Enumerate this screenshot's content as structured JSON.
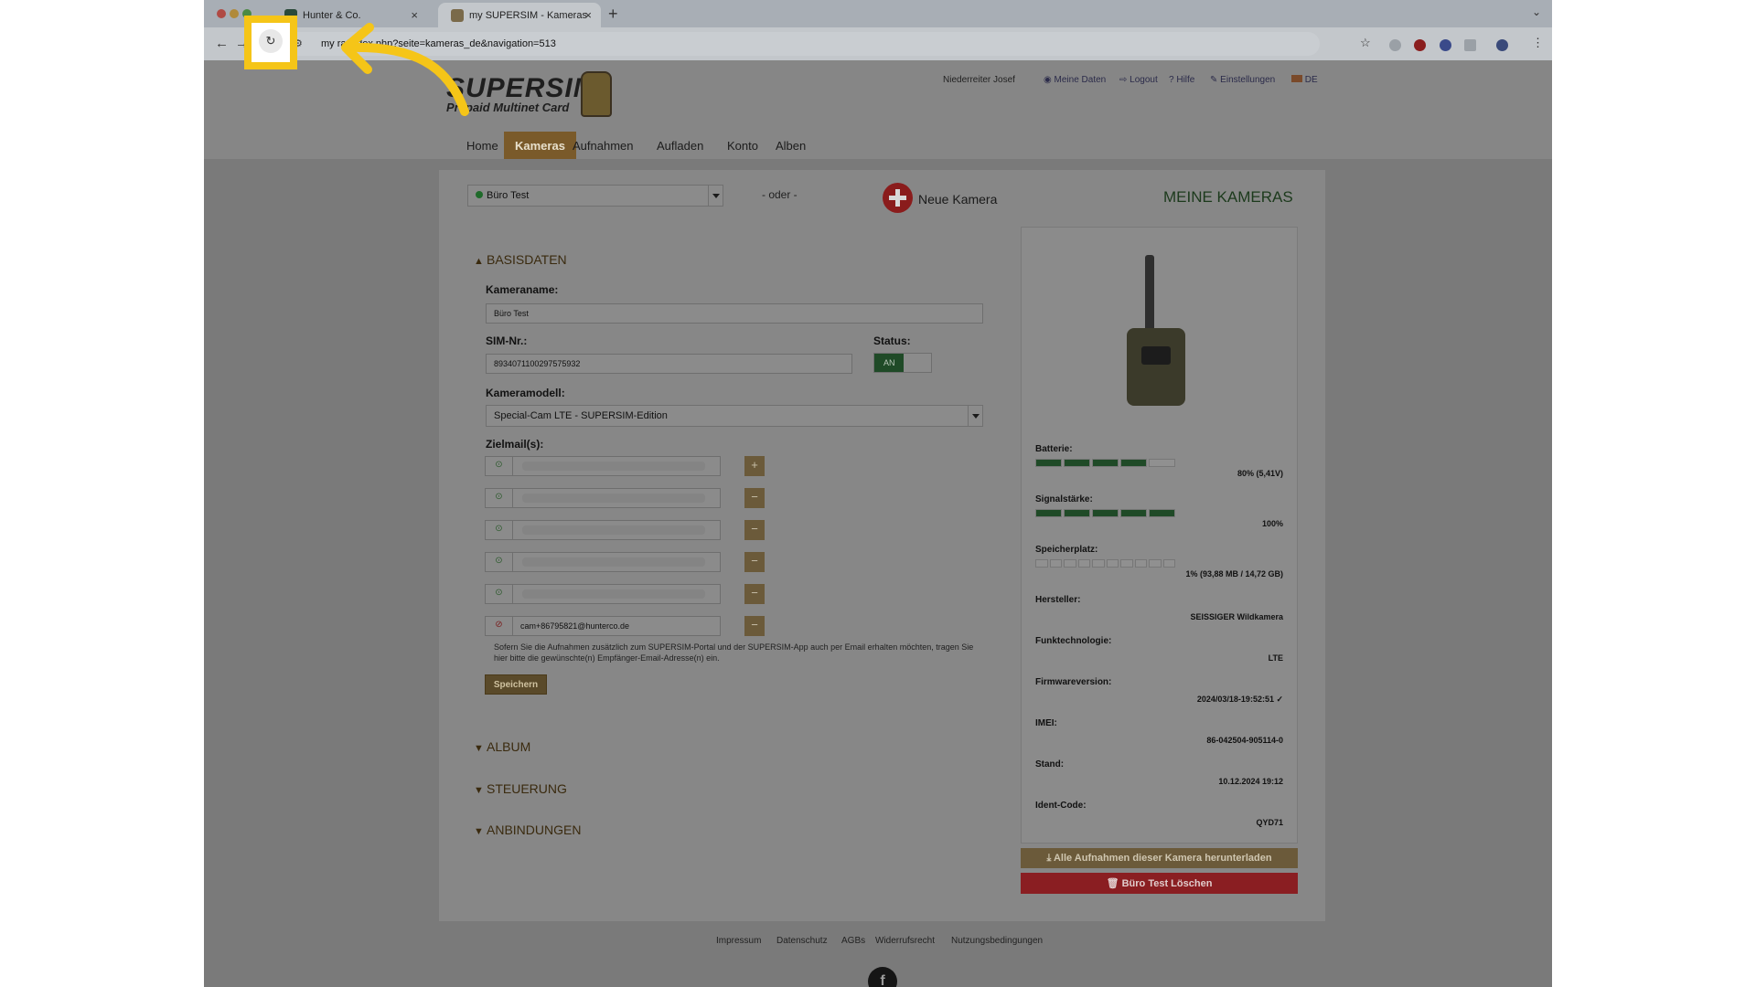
{
  "browser": {
    "tabs": [
      {
        "label": "Hunter & Co."
      },
      {
        "label": "my SUPERSIM - Kameras"
      }
    ],
    "url": "my                    ra/index.php?seite=kameras_de&navigation=513"
  },
  "site": {
    "logo_line1": "SUPERSIM",
    "logo_line2": "Prepaid Multinet Card",
    "user_name": "Niederreiter Josef",
    "user_links": [
      "Meine Daten",
      "Logout",
      "Hilfe",
      "Einstellungen",
      "DE"
    ],
    "nav": [
      "Home",
      "Kameras",
      "Aufnahmen",
      "Aufladen",
      "Konto",
      "Alben"
    ]
  },
  "toolbar": {
    "selected_camera": "Büro Test",
    "oder": "- oder -",
    "neue_kamera": "Neue Kamera",
    "title": "MEINE KAMERAS"
  },
  "basisdaten": {
    "heading": "BASISDATEN",
    "kameraname_label": "Kameraname:",
    "kameraname_value": "Büro Test",
    "sim_label": "SIM-Nr.:",
    "sim_value": "8934071100297575932",
    "status_label": "Status:",
    "status_value": "AN",
    "modell_label": "Kameramodell:",
    "modell_value": "Special-Cam LTE - SUPERSIM-Edition",
    "zielmail_label": "Zielmail(s):",
    "last_mail": "cam+86795821@hunterco.de",
    "hint": "Sofern Sie die Aufnahmen zusätzlich zum SUPERSIM-Portal und der SUPERSIM-App auch per Email erhalten möchten, tragen Sie hier bitte die gewünschte(n) Empfänger-Email-Adresse(n) ein.",
    "save": "Speichern"
  },
  "sections": [
    "ALBUM",
    "STEUERUNG",
    "ANBINDUNGEN"
  ],
  "camera_info": {
    "batterie_label": "Batterie:",
    "batterie_value": "80% (5,41V)",
    "batterie_level": 0.8,
    "signal_label": "Signalstärke:",
    "signal_value": "100%",
    "signal_level": 1.0,
    "speicher_label": "Speicherplatz:",
    "speicher_value": "1% (93,88 MB / 14,72 GB)",
    "speicher_level": 0.01,
    "hersteller_label": "Hersteller:",
    "hersteller_value": "SEISSIGER Wildkamera",
    "funk_label": "Funktechnologie:",
    "funk_value": "LTE",
    "firmware_label": "Firmwareversion:",
    "firmware_value": "2024/03/18-19:52:51 ✓",
    "imei_label": "IMEI:",
    "imei_value": "86-042504-905114-0",
    "stand_label": "Stand:",
    "stand_value": "10.12.2024 19:12",
    "ident_label": "Ident-Code:",
    "ident_value": "QYD71"
  },
  "actions": {
    "download": "Alle Aufnahmen dieser Kamera herunterladen",
    "delete": "Büro Test Löschen"
  },
  "footer": [
    "Impressum",
    "Datenschutz",
    "AGBs",
    "Widerrufsrecht",
    "Nutzungsbedingungen"
  ],
  "icons": {
    "reload": "reload-icon",
    "facebook": "f"
  },
  "colors": {
    "highlight": "#f5c518",
    "brand_brown": "#7a5a2a",
    "delete_red": "#8a1e22",
    "status_green": "#1f4a27"
  }
}
